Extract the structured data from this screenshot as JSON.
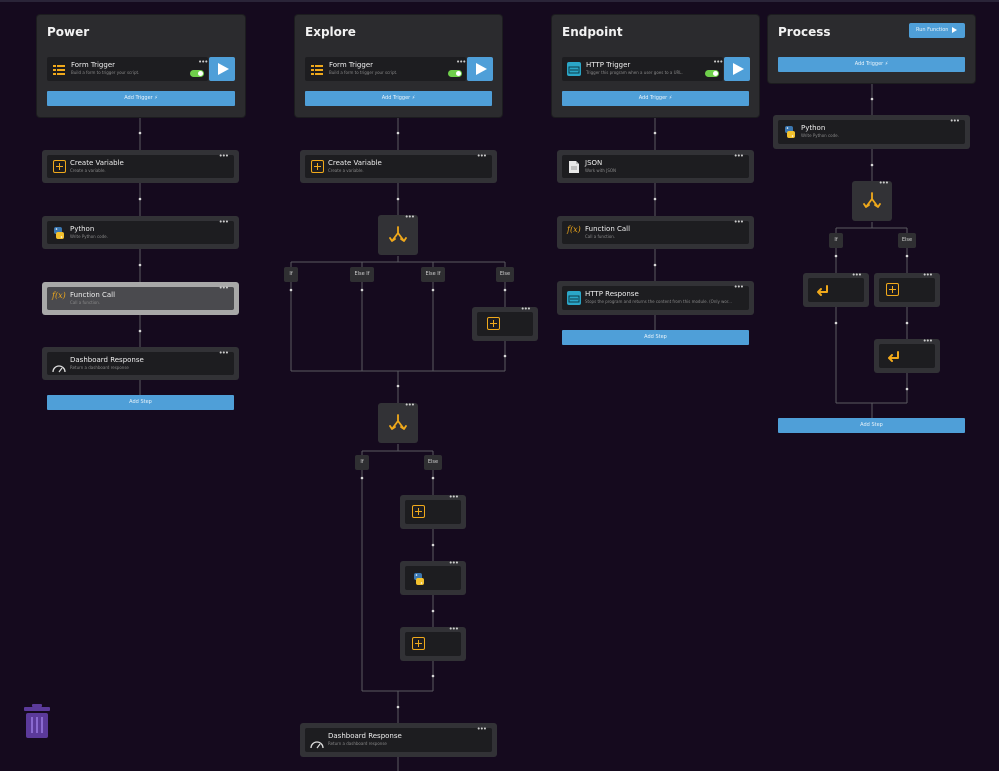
{
  "columns": [
    {
      "title": "Power",
      "trigger": {
        "name": "Form Trigger",
        "desc": "Build a form to trigger your script."
      },
      "add_trigger": "Add Trigger",
      "steps": [
        {
          "name": "Create Variable",
          "desc": "Create a variable.",
          "icon": "plus-square-icon"
        },
        {
          "name": "Python",
          "desc": "Write Python code.",
          "icon": "python-icon"
        },
        {
          "name": "Function Call",
          "desc": "Call a function.",
          "icon": "function-icon"
        },
        {
          "name": "Dashboard Response",
          "desc": "Return a dashboard response",
          "icon": "gauge-icon"
        }
      ],
      "add_step": "Add Step"
    },
    {
      "title": "Explore",
      "trigger": {
        "name": "Form Trigger",
        "desc": "Build a form to trigger your script."
      },
      "add_trigger": "Add Trigger",
      "steps": [
        {
          "name": "Create Variable",
          "desc": "Create a variable.",
          "icon": "plus-square-icon"
        },
        {
          "name": "Dashboard Response",
          "desc": "Return a dashboard response",
          "icon": "gauge-icon"
        }
      ],
      "branch1_labels": [
        "If",
        "Else If",
        "Else If",
        "Else"
      ],
      "branch2_labels": [
        "If",
        "Else"
      ]
    },
    {
      "title": "Endpoint",
      "trigger": {
        "name": "HTTP Trigger",
        "desc": "Trigger this program when a user goes to a URL."
      },
      "add_trigger": "Add Trigger",
      "steps": [
        {
          "name": "JSON",
          "desc": "Work with JSON",
          "icon": "document-icon"
        },
        {
          "name": "Function Call",
          "desc": "Call a function.",
          "icon": "function-icon"
        },
        {
          "name": "HTTP Response",
          "desc": "Stops the program and returns the content from this module. (Only wor...",
          "icon": "http-icon"
        }
      ],
      "add_step": "Add Step"
    },
    {
      "title": "Process",
      "run_function": "Run Function",
      "add_trigger": "Add Trigger",
      "steps": [
        {
          "name": "Python",
          "desc": "Write Python code.",
          "icon": "python-icon"
        }
      ],
      "branch_labels": [
        "If",
        "Else"
      ],
      "add_step": "Add Step"
    }
  ],
  "dots": "•••",
  "colors": {
    "background": "#150a1e",
    "panel": "#2b2b2e",
    "accent_blue": "#4f9fd8",
    "icon_orange": "#f0a91b",
    "toggle_green": "#6fcf4b",
    "trash_purple": "#5b3a9a"
  }
}
